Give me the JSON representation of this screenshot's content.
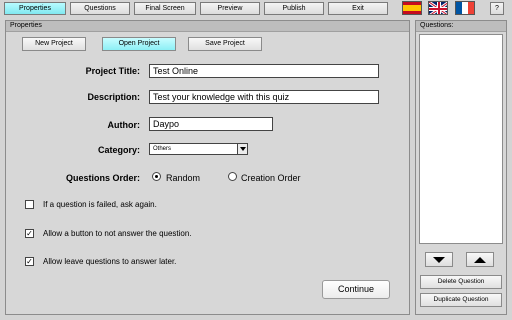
{
  "topbar": {
    "tabs": [
      {
        "label": "Properties",
        "active": true
      },
      {
        "label": "Questions",
        "active": false
      },
      {
        "label": "Final Screen",
        "active": false
      },
      {
        "label": "Preview",
        "active": false
      },
      {
        "label": "Publish",
        "active": false
      },
      {
        "label": "Exit",
        "active": false
      }
    ],
    "languages": [
      "spanish-flag-icon",
      "uk-flag-icon",
      "french-flag-icon"
    ],
    "help_label": "?"
  },
  "properties": {
    "panel_title": "Properties",
    "buttons": {
      "new_project": "New Project",
      "open_project": "Open Project",
      "save_project": "Save Project"
    },
    "project_title": {
      "label": "Project Title:",
      "value": "Test Online"
    },
    "description": {
      "label": "Description:",
      "value": "Test your knowledge with this quiz"
    },
    "author": {
      "label": "Author:",
      "value": "Daypo"
    },
    "category": {
      "label": "Category:",
      "value": "Others"
    },
    "questions_order": {
      "label": "Questions Order:",
      "options": [
        {
          "label": "Random",
          "selected": true
        },
        {
          "label": "Creation Order",
          "selected": false
        }
      ]
    },
    "checkboxes": [
      {
        "label": "If a question is failed, ask again.",
        "checked": false
      },
      {
        "label": "Allow a button to not answer the question.",
        "checked": true
      },
      {
        "label": "Allow leave questions to answer later.",
        "checked": true
      }
    ],
    "continue_label": "Continue"
  },
  "questions_panel": {
    "title": "Questions:",
    "delete_label": "Delete Question",
    "duplicate_label": "Duplicate Question"
  },
  "colors": {
    "accent": "#80e8f0",
    "background": "#d4d4d4"
  }
}
